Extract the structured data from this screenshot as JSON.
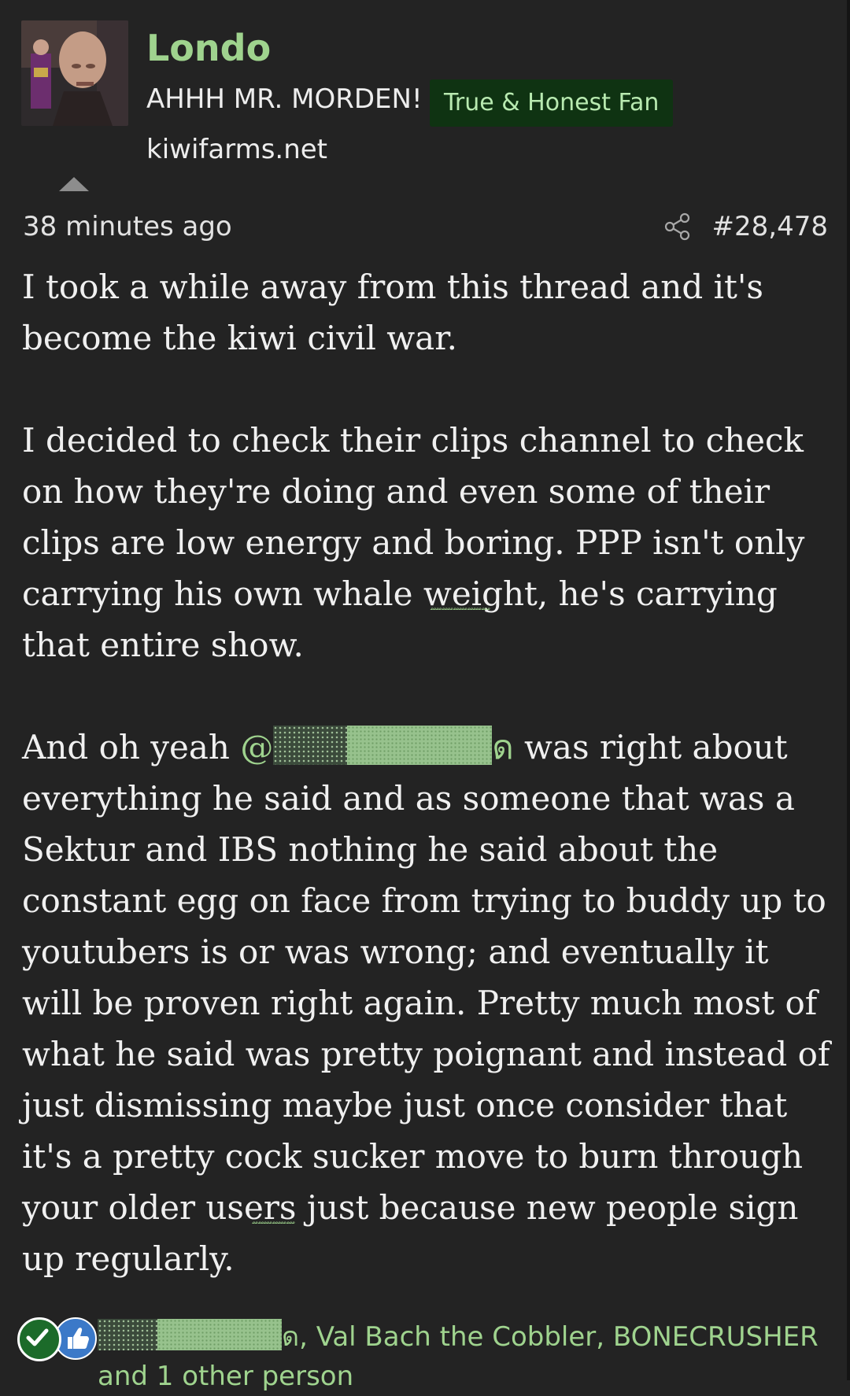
{
  "author": {
    "username": "Londo",
    "user_title": "AHHH MR. MORDEN!",
    "badge": "True & Honest Fan",
    "site": "kiwifarms.net"
  },
  "post": {
    "time": "38 minutes ago",
    "number": "#28,478",
    "paragraph1": "I took a while away from this thread and it's become the kiwi civil war.",
    "paragraph2": "I decided to check their clips channel to check on how they're doing and even some of their clips are low energy and boring. PPP isn't only carrying his own whale weight, he's carrying that entire show.",
    "p3_start": "And oh yeah ",
    "mention_prefix": "@",
    "mention_suffix": "ด",
    "p3_rest": " was right about everything he said and as someone that was a Sektur and IBS nothing he said about the constant egg on face from trying to buddy up to youtubers is or was wrong; and eventually it will be proven right again. Pretty much most of what he said was pretty poignant and instead of just dismissing maybe just once consider that it's a pretty cock sucker move to burn through your older users just because new people sign up regularly."
  },
  "reactions": {
    "users_suffix": "ด, Val Bach the Cobbler, BONECRUSHER",
    "others": "and 1 other person"
  },
  "icons": {
    "share": "share-icon",
    "like": "like-icon",
    "check": "check-icon",
    "collapse": "arrow-up-icon"
  }
}
